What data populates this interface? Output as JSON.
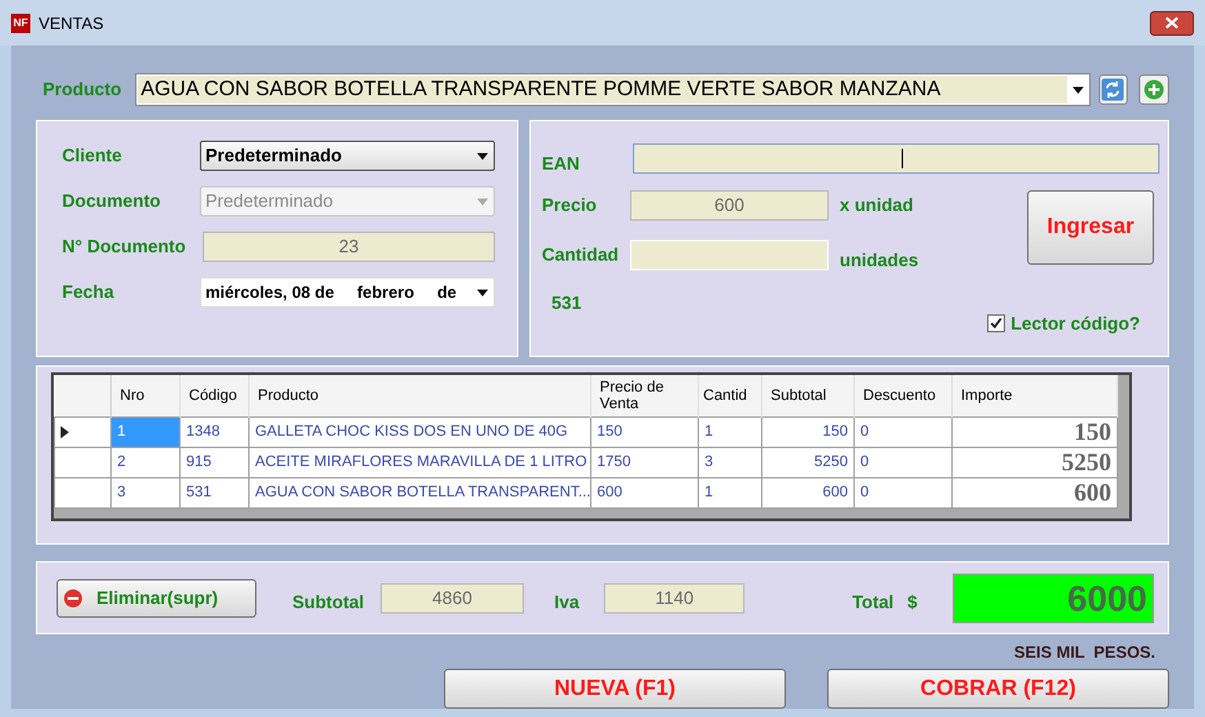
{
  "window": {
    "title": "VENTAS",
    "logo": "NF"
  },
  "producto": {
    "label": "Producto",
    "value": "AGUA CON SABOR BOTELLA TRANSPARENTE POMME VERTE SABOR MANZANA"
  },
  "cliente_panel": {
    "fields": [
      {
        "kind": "select",
        "label": "Cliente",
        "value": "Predeterminado",
        "disabled": false
      },
      {
        "kind": "select",
        "label": "Documento",
        "value": "Predeterminado",
        "disabled": true
      },
      {
        "kind": "text",
        "label": "N° Documento",
        "value": "23"
      },
      {
        "kind": "date",
        "label": "Fecha",
        "value": "miércoles, 08 de     febrero     de"
      }
    ]
  },
  "item_panel": {
    "ean_label": "EAN",
    "precio_label": "Precio",
    "precio": "600",
    "precio_unit": "x unidad",
    "cantidad_label": "Cantidad",
    "cantidad_unit": "unidades",
    "codigo": "531",
    "ingresar": "Ingresar",
    "lector": {
      "label": "Lector código?",
      "checked": true
    }
  },
  "table": {
    "columns": [
      "Nro",
      "Código",
      "Producto",
      "Precio de Venta",
      "Cantid",
      "Subtotal",
      "Descuento",
      "Importe"
    ],
    "rows": [
      {
        "selected": true,
        "cells": [
          "1",
          "1348",
          "GALLETA CHOC KISS  DOS EN UNO DE 40G",
          "150",
          "1",
          "150",
          "0",
          "150"
        ]
      },
      {
        "selected": false,
        "cells": [
          "2",
          "915",
          "ACEITE MIRAFLORES  MARAVILLA  DE 1 LITRO",
          "1750",
          "3",
          "5250",
          "0",
          "5250"
        ]
      },
      {
        "selected": false,
        "cells": [
          "3",
          "531",
          "AGUA CON SABOR BOTELLA TRANSPARENT...",
          "600",
          "1",
          "600",
          "0",
          "600"
        ]
      }
    ]
  },
  "totals": {
    "eliminar": "Eliminar(supr)",
    "subtotal_label": "Subtotal",
    "subtotal": "4860",
    "iva_label": "Iva",
    "iva": "1140",
    "total_label": "Total",
    "currency": "$",
    "total": "6000",
    "in_words": "SEIS MIL  PESOS."
  },
  "buttons": [
    "NUEVA (F1)",
    "COBRAR (F12)"
  ]
}
